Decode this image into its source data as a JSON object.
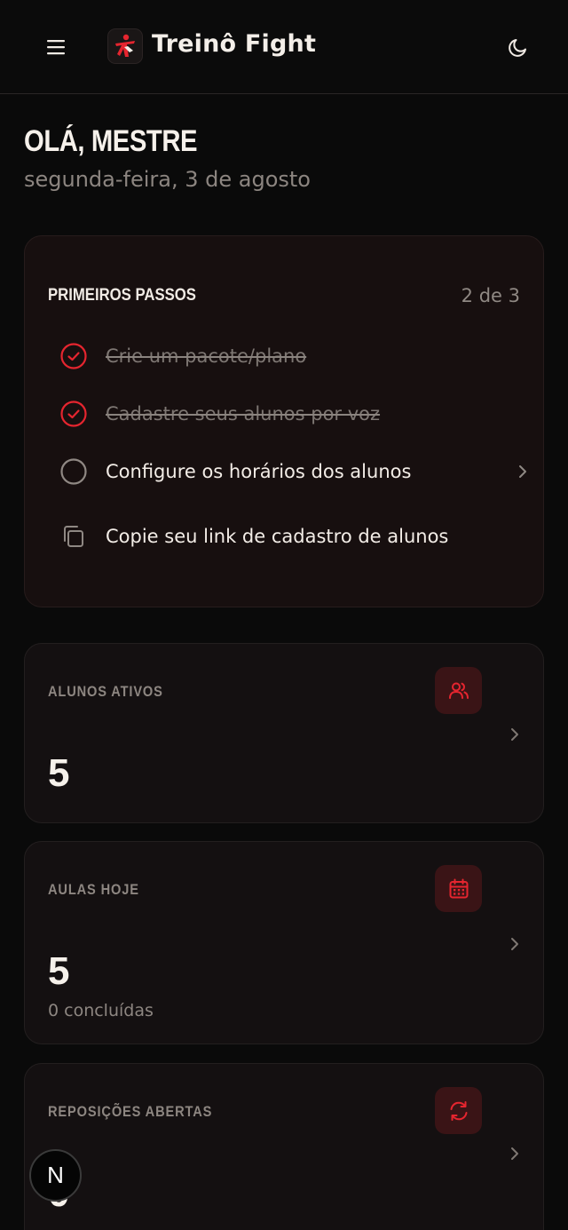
{
  "header": {
    "brand": "Treinô Fight",
    "menu_icon": "menu-icon",
    "theme_icon": "moon-icon"
  },
  "greeting": {
    "title": "OLÁ, MESTRE",
    "date": "segunda-feira, 3 de agosto"
  },
  "onboarding": {
    "title": "PRIMEIROS PASSOS",
    "progress": "2 de 3",
    "steps": [
      {
        "label": "Crie um pacote/plano",
        "status": "done"
      },
      {
        "label": "Cadastre seus alunos por voz",
        "status": "done"
      },
      {
        "label": "Configure os horários dos alunos",
        "status": "pending"
      },
      {
        "label": "Copie seu link de cadastro de alunos",
        "status": "action"
      }
    ]
  },
  "stats": [
    {
      "label": "ALUNOS ATIVOS",
      "value": "5",
      "sub": "",
      "icon": "users-icon"
    },
    {
      "label": "AULAS HOJE",
      "value": "5",
      "sub": "0 concluídas",
      "icon": "calendar-icon"
    },
    {
      "label": "REPOSIÇÕES ABERTAS",
      "value": "0",
      "sub": "",
      "icon": "refresh-icon"
    }
  ],
  "dev_badge": "N",
  "colors": {
    "accent": "#e5252f",
    "background": "#0a0a0a",
    "card": "#141011"
  }
}
